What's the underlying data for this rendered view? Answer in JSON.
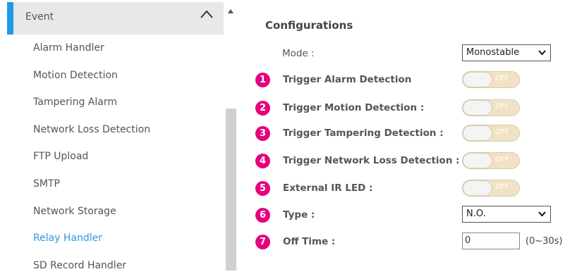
{
  "sidebar": {
    "title": "Event",
    "items": [
      {
        "label": "Alarm Handler"
      },
      {
        "label": "Motion Detection"
      },
      {
        "label": "Tampering Alarm"
      },
      {
        "label": "Network Loss Detection"
      },
      {
        "label": "FTP Upload"
      },
      {
        "label": "SMTP"
      },
      {
        "label": "Network Storage"
      },
      {
        "label": "Relay Handler",
        "active": true
      },
      {
        "label": "SD Record Handler"
      }
    ],
    "accent_color": "#1e9be6",
    "active_color": "#2f9ad6",
    "icons": {
      "collapse": "chevron-up-icon",
      "scroll_up": "scroll-up-arrow-icon"
    }
  },
  "config": {
    "title": "Configurations",
    "mode": {
      "label": "Mode :",
      "value": "Monostable"
    },
    "trigger_alarm": {
      "num": "1",
      "label": "Trigger Alarm Detection",
      "state": "OFF"
    },
    "trigger_motion": {
      "num": "2",
      "label": "Trigger Motion Detection :",
      "state": "OFF"
    },
    "trigger_tampering": {
      "num": "3",
      "label": "Trigger Tampering Detection :",
      "state": "OFF"
    },
    "trigger_network_loss": {
      "num": "4",
      "label": "Trigger Network Loss Detection :",
      "state": "OFF"
    },
    "external_ir_led": {
      "num": "5",
      "label": "External IR LED :",
      "state": "OFF"
    },
    "type": {
      "num": "6",
      "label": "Type :",
      "value": "N.O."
    },
    "off_time": {
      "num": "7",
      "label": "Off Time :",
      "value": "0",
      "unit": "(0~30s)"
    },
    "badge_color": "#e6007e"
  }
}
